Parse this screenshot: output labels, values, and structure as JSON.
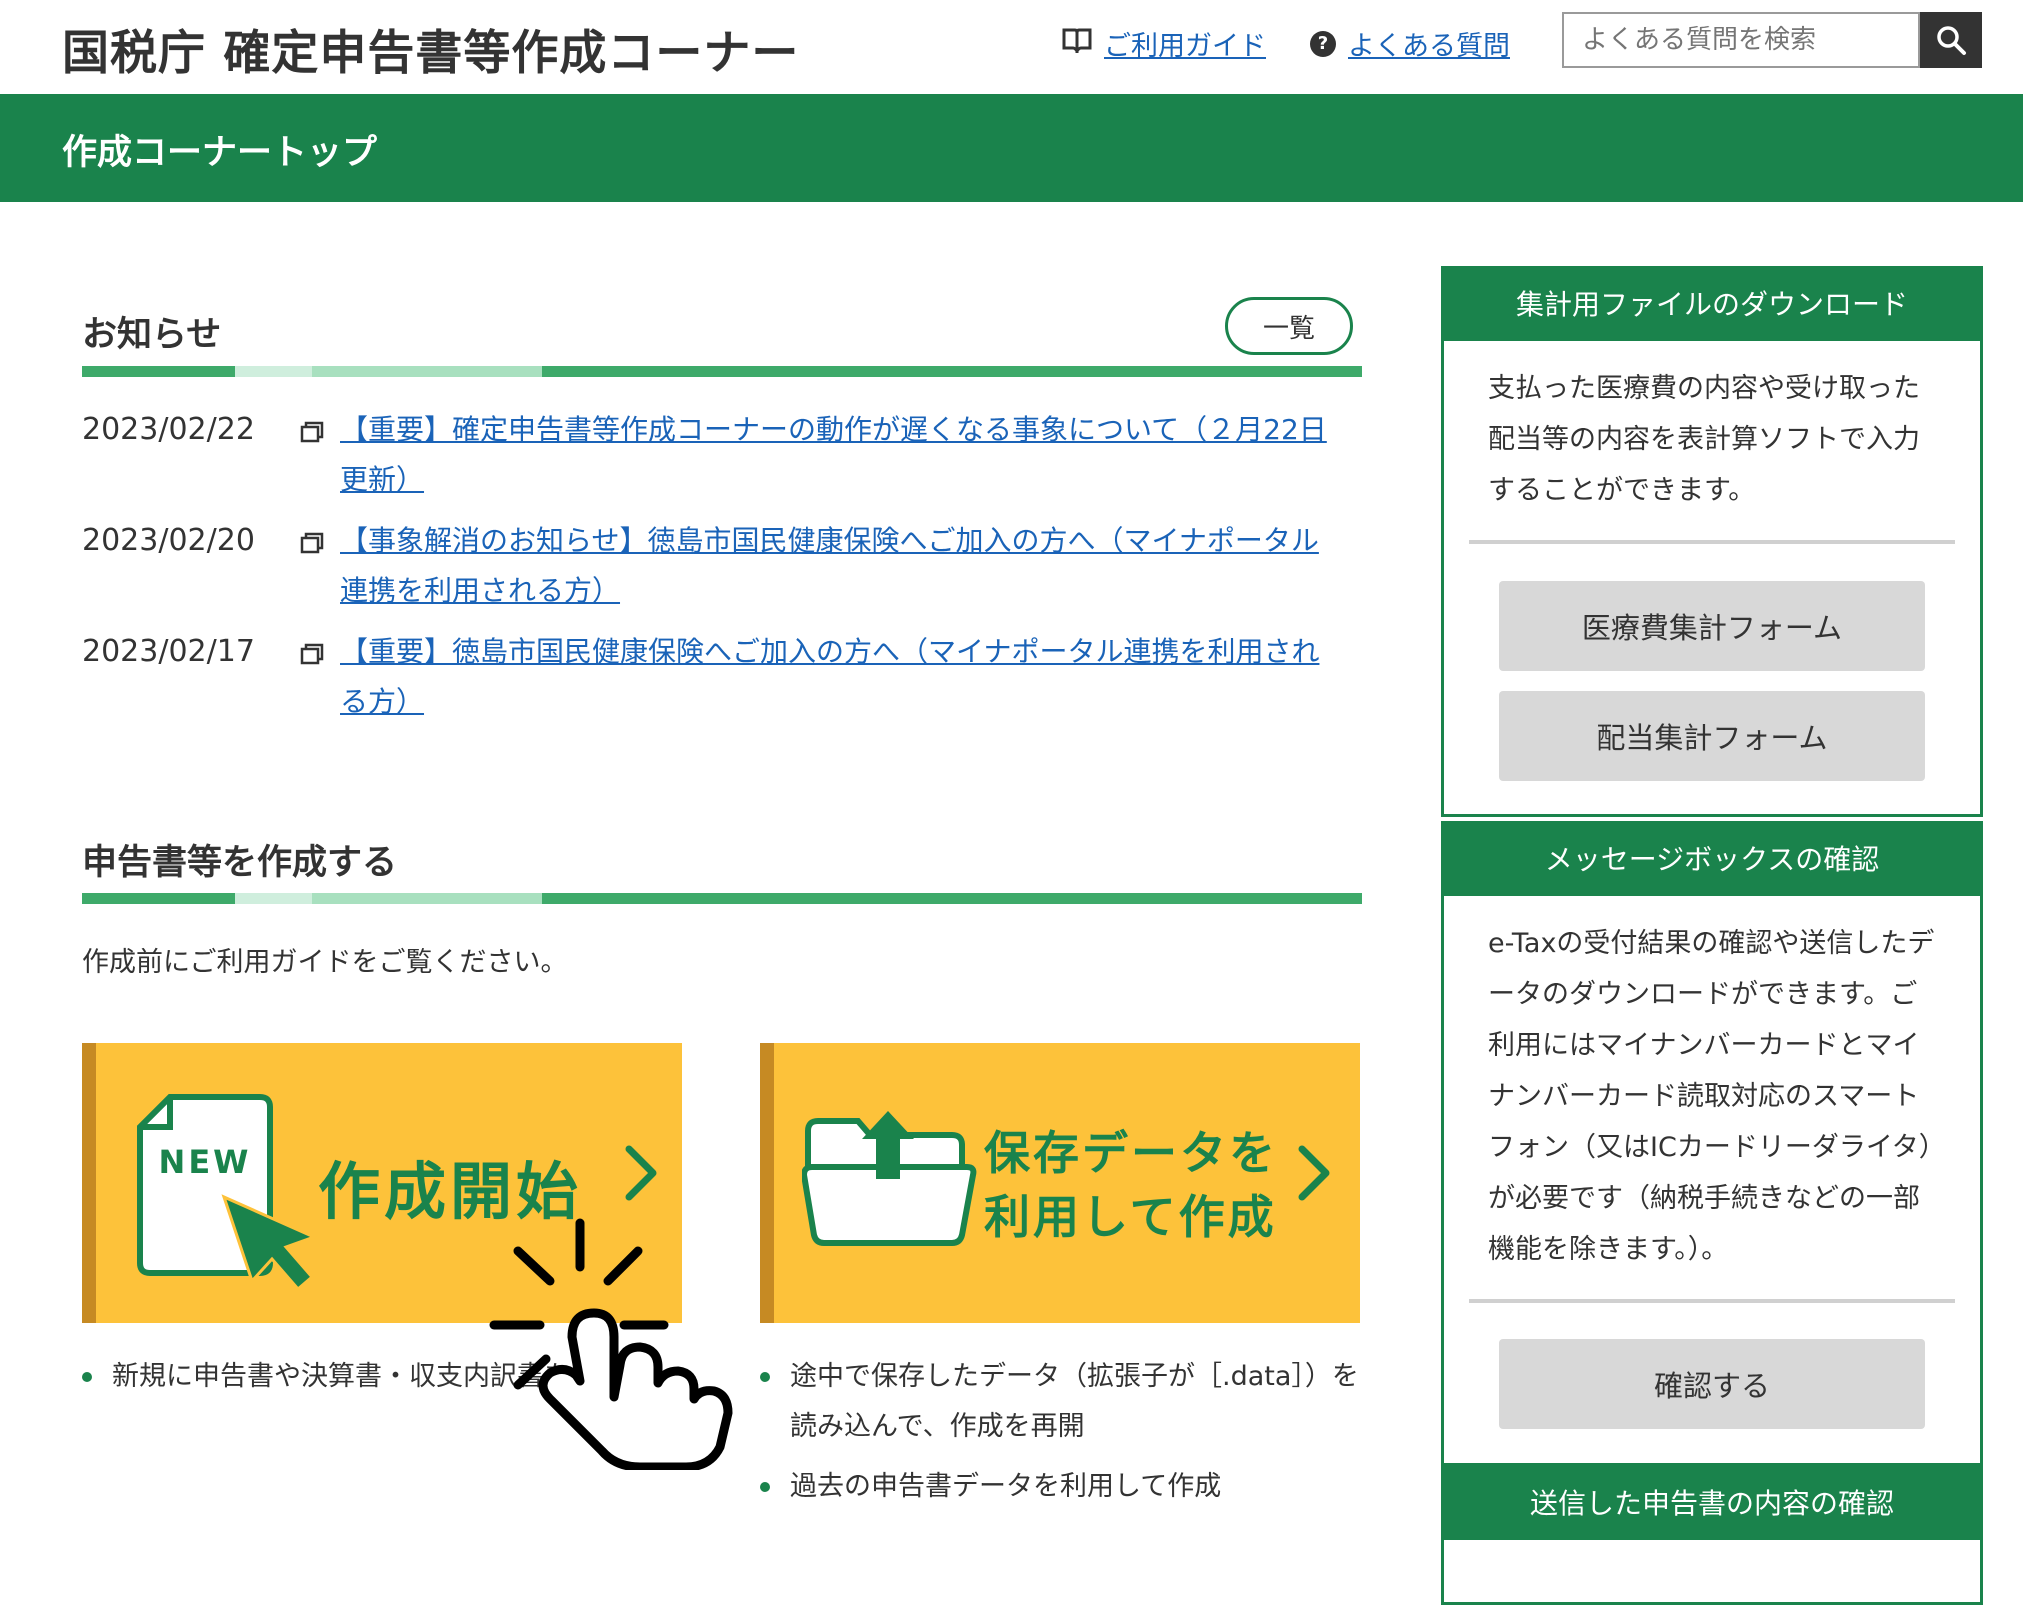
{
  "header": {
    "site_title": "国税庁 確定申告書等作成コーナー",
    "guide_link": "ご利用ガイド",
    "faq_link": "よくある質問",
    "search_placeholder": "よくある質問を検索",
    "page_title": "作成コーナートップ"
  },
  "news": {
    "heading": "お知らせ",
    "list_button": "一覧",
    "items": [
      {
        "date": "2023/02/22",
        "title": "【重要】確定申告書等作成コーナーの動作が遅くなる事象について（２月22日更新）"
      },
      {
        "date": "2023/02/20",
        "title": "【事象解消のお知らせ】徳島市国民健康保険へご加入の方へ（マイナポータル連携を利用される方）"
      },
      {
        "date": "2023/02/17",
        "title": "【重要】徳島市国民健康保険へご加入の方へ（マイナポータル連携を利用される方）"
      }
    ]
  },
  "create": {
    "heading": "申告書等を作成する",
    "intro": "作成前にご利用ガイドをご覧ください。",
    "new_card": {
      "badge": "NEW",
      "label": "作成開始",
      "bullets": [
        "新規に申告書や決算書・収支内訳書を作成"
      ]
    },
    "saved_card": {
      "label_line1": "保存データを",
      "label_line2": "利用して作成",
      "bullets": [
        "途中で保存したデータ（拡張子が［.data］）を読み込んで、作成を再開",
        "過去の申告書データを利用して作成"
      ]
    }
  },
  "sidebar": {
    "download": {
      "heading": "集計用ファイルのダウンロード",
      "text": "支払った医療費の内容や受け取った配当等の内容を表計算ソフトで入力することができます。",
      "button1": "医療費集計フォーム",
      "button2": "配当集計フォーム"
    },
    "messagebox": {
      "heading": "メッセージボックスの確認",
      "text": "e-Taxの受付結果の確認や送信したデータのダウンロードができます。ご利用にはマイナンバーカードとマイナンバーカード読取対応のスマートフォン（又はICカードリーダライタ）が必要です（納税手続きなどの一部機能を除きます。）。",
      "button": "確認する"
    },
    "sent": {
      "heading": "送信した申告書の内容の確認"
    }
  },
  "icons": {
    "guide": "book-icon",
    "faq": "question-icon",
    "search": "search-icon",
    "external": "window-icon",
    "pointer": "hand-pointer-icon"
  },
  "colors": {
    "brand_green": "#1a834c",
    "card_yellow": "#fdc23a",
    "link_blue": "#1a63b8"
  }
}
